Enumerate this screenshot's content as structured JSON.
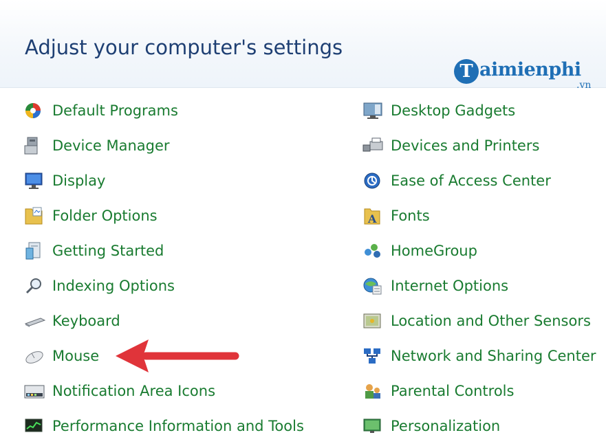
{
  "page": {
    "title": "Adjust your computer's settings"
  },
  "watermark": {
    "letter": "T",
    "name": "aimienphi",
    "suffix": ".vn"
  },
  "colors": {
    "title": "#1e3f73",
    "link": "#197b30",
    "arrow": "#e0343a",
    "brand": "#1f6fb5"
  },
  "left_items": [
    {
      "label": "Default Programs",
      "icon": "default-programs-icon"
    },
    {
      "label": "Device Manager",
      "icon": "device-manager-icon"
    },
    {
      "label": "Display",
      "icon": "display-icon"
    },
    {
      "label": "Folder Options",
      "icon": "folder-options-icon"
    },
    {
      "label": "Getting Started",
      "icon": "getting-started-icon"
    },
    {
      "label": "Indexing Options",
      "icon": "indexing-options-icon"
    },
    {
      "label": "Keyboard",
      "icon": "keyboard-icon"
    },
    {
      "label": "Mouse",
      "icon": "mouse-icon"
    },
    {
      "label": "Notification Area Icons",
      "icon": "notification-area-icon"
    },
    {
      "label": "Performance Information and Tools",
      "icon": "performance-icon"
    }
  ],
  "right_items": [
    {
      "label": "Desktop Gadgets",
      "icon": "desktop-gadgets-icon"
    },
    {
      "label": "Devices and Printers",
      "icon": "devices-printers-icon"
    },
    {
      "label": "Ease of Access Center",
      "icon": "ease-of-access-icon"
    },
    {
      "label": "Fonts",
      "icon": "fonts-icon"
    },
    {
      "label": "HomeGroup",
      "icon": "homegroup-icon"
    },
    {
      "label": "Internet Options",
      "icon": "internet-options-icon"
    },
    {
      "label": "Location and Other Sensors",
      "icon": "location-sensors-icon"
    },
    {
      "label": "Network and Sharing Center",
      "icon": "network-sharing-icon"
    },
    {
      "label": "Parental Controls",
      "icon": "parental-controls-icon"
    },
    {
      "label": "Personalization",
      "icon": "personalization-icon"
    }
  ]
}
